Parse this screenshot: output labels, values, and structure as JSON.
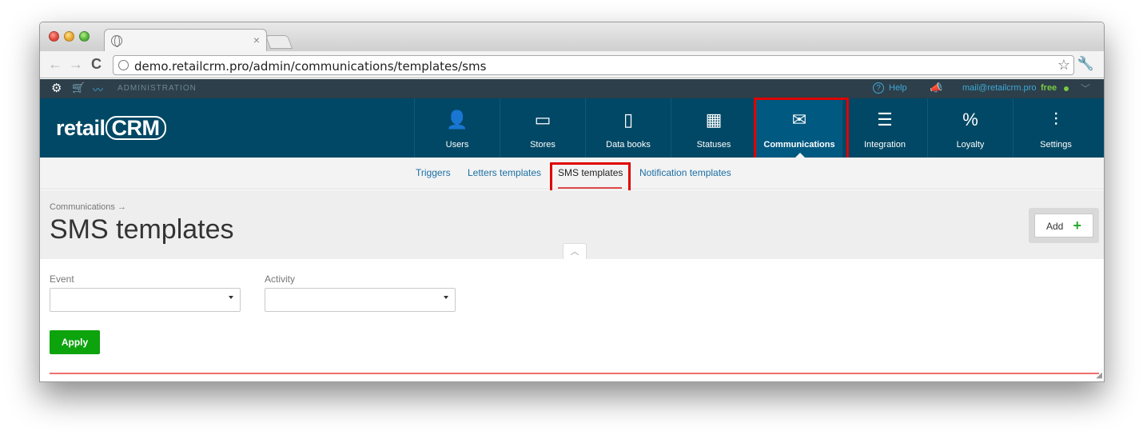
{
  "browser": {
    "tab_close": "×",
    "url": "demo.retailcrm.pro/admin/communications/templates/sms",
    "back_glyph": "←",
    "forward_glyph": "→",
    "reload_glyph": "C",
    "star_glyph": "☆",
    "wrench_glyph": "🔧"
  },
  "adminbar": {
    "label": "ADMINISTRATION",
    "help": "Help",
    "help_glyph": "?",
    "email": "mail@retailcrm.pro",
    "plan": "free",
    "icons": [
      "gear-icon",
      "cart-icon",
      "chart-icon",
      "help-icon",
      "megaphone-icon",
      "chevron-down-icon"
    ]
  },
  "logo": {
    "left": "retail",
    "crm": "CRM"
  },
  "nav": {
    "items": [
      {
        "label": "Users",
        "glyph": "👤",
        "icon": "user-icon"
      },
      {
        "label": "Stores",
        "glyph": "▭",
        "icon": "store-icon"
      },
      {
        "label": "Data books",
        "glyph": "▯",
        "icon": "book-icon"
      },
      {
        "label": "Statuses",
        "glyph": "▦",
        "icon": "statuses-icon"
      },
      {
        "label": "Communications",
        "glyph": "✉",
        "icon": "mail-icon"
      },
      {
        "label": "Integration",
        "glyph": "☰",
        "icon": "integration-icon"
      },
      {
        "label": "Loyalty",
        "glyph": "%",
        "icon": "loyalty-icon"
      },
      {
        "label": "Settings",
        "glyph": "⫶",
        "icon": "settings-sliders-icon"
      }
    ],
    "active": "Communications"
  },
  "subnav": {
    "items": [
      {
        "label": "Triggers"
      },
      {
        "label": "Letters templates"
      },
      {
        "label": "SMS templates"
      },
      {
        "label": "Notification templates"
      }
    ],
    "current": "SMS templates"
  },
  "page": {
    "breadcrumb": "Communications →",
    "title": "SMS templates",
    "add_label": "Add",
    "add_glyph": "+",
    "collapse_glyph": "︿"
  },
  "filters": {
    "event_label": "Event",
    "event_value": "",
    "activity_label": "Activity",
    "activity_value": "",
    "apply_label": "Apply"
  },
  "colors": {
    "header": "#004865",
    "adminbar": "#2c3f4a",
    "link": "#1b6fa3",
    "apply": "#0da30d",
    "highlight": "#e00000"
  }
}
